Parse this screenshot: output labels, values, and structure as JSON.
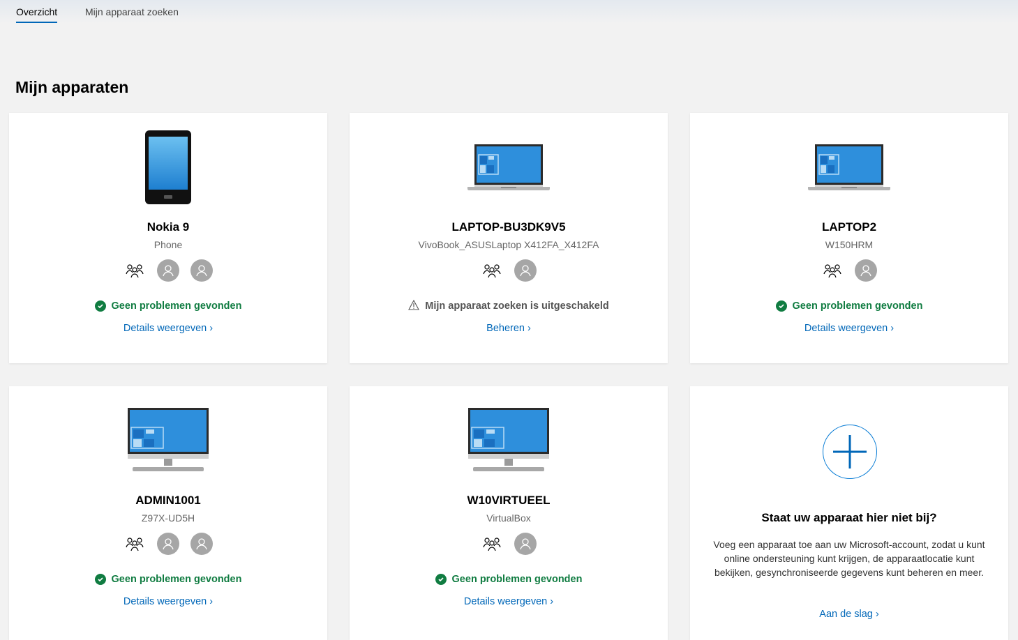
{
  "tabs": [
    {
      "label": "Overzicht",
      "active": true
    },
    {
      "label": "Mijn apparaat zoeken",
      "active": false
    }
  ],
  "page_title": "Mijn apparaten",
  "colors": {
    "accent": "#0067b8",
    "ok": "#107c41",
    "background": "#f2f2f2"
  },
  "devices": [
    {
      "name": "Nokia 9",
      "model": "Phone",
      "type": "phone-icon",
      "status": "Geen problemen gevonden",
      "status_kind": "ok",
      "link": "Details weergeven"
    },
    {
      "name": "LAPTOP-BU3DK9V5",
      "model": "VivoBook_ASUSLaptop X412FA_X412FA",
      "type": "laptop-icon",
      "status": "Mijn apparaat zoeken is uitgeschakeld",
      "status_kind": "warning",
      "link": "Beheren"
    },
    {
      "name": "LAPTOP2",
      "model": "W150HRM",
      "type": "laptop-icon",
      "status": "Geen problemen gevonden",
      "status_kind": "ok",
      "link": "Details weergeven"
    },
    {
      "name": "ADMIN1001",
      "model": "Z97X-UD5H",
      "type": "desktop-icon",
      "status": "Geen problemen gevonden",
      "status_kind": "ok",
      "link": "Details weergeven"
    },
    {
      "name": "W10VIRTUEEL",
      "model": "VirtualBox",
      "type": "desktop-icon",
      "status": "Geen problemen gevonden",
      "status_kind": "ok",
      "link": "Details weergeven"
    }
  ],
  "add_device": {
    "title": "Staat uw apparaat hier niet bij?",
    "description": "Voeg een apparaat toe aan uw Microsoft-account, zodat u kunt online ondersteuning kunt krijgen, de apparaatlocatie kunt bekijken, gesynchroniseerde gegevens kunt beheren en meer.",
    "link": "Aan de slag"
  }
}
